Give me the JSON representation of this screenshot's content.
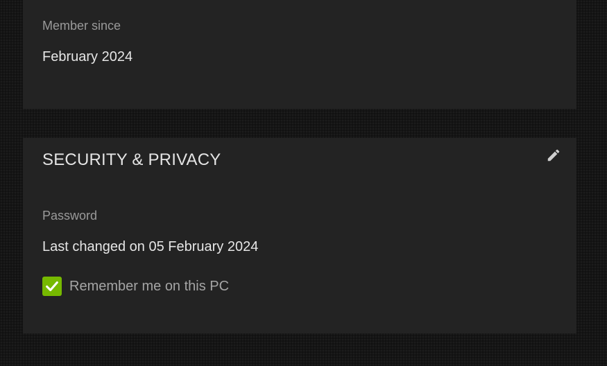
{
  "member": {
    "label": "Member since",
    "value": "February 2024"
  },
  "security": {
    "title": "SECURITY & PRIVACY",
    "edit_icon": "pencil-icon",
    "password_label": "Password",
    "password_value": "Last changed on 05 February 2024",
    "remember_label": "Remember me on this PC",
    "remember_checked": true
  },
  "colors": {
    "accent": "#76b900",
    "panel": "#232323",
    "background": "#151515"
  }
}
